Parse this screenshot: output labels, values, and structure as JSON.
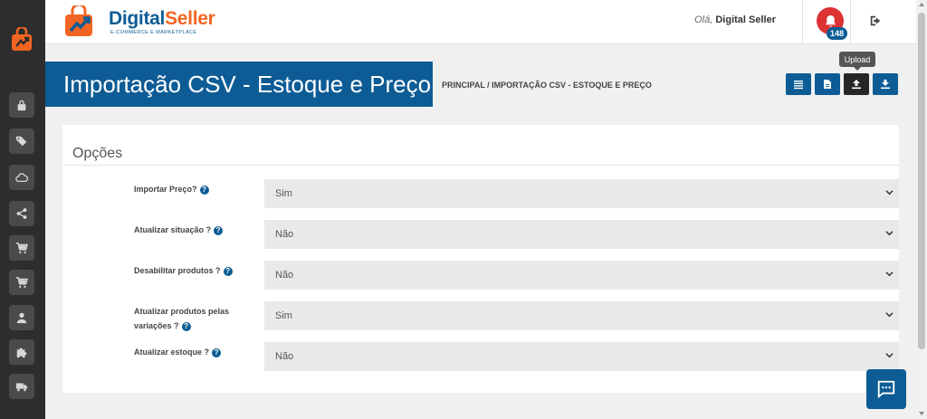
{
  "brand": {
    "name_part1": "Digital",
    "name_part2": "Seller",
    "tagline": "E-COMMERCE E MARKETPLACE",
    "colors": {
      "primary": "#0d5c95",
      "accent": "#f26522",
      "alert": "#dc3232"
    }
  },
  "sidebar": {
    "items": [
      {
        "icon": "lock-icon"
      },
      {
        "icon": "tags-icon"
      },
      {
        "icon": "cloud-icon"
      },
      {
        "icon": "share-icon"
      },
      {
        "icon": "cart-icon"
      },
      {
        "icon": "cart-icon"
      },
      {
        "icon": "user-icon"
      },
      {
        "icon": "puzzle-icon"
      },
      {
        "icon": "truck-icon"
      }
    ]
  },
  "header": {
    "greeting_prefix": "Olá,",
    "user_name": "Digital Seller",
    "notification_count": "148"
  },
  "page": {
    "title": "Importação CSV - Estoque e Preço",
    "breadcrumb": "PRINCIPAL / IMPORTAÇÃO CSV - ESTOQUE E PREÇO"
  },
  "toolbar": {
    "tooltip": "Upload",
    "buttons": [
      {
        "icon": "list-icon"
      },
      {
        "icon": "file-icon"
      },
      {
        "icon": "upload-icon"
      },
      {
        "icon": "download-icon"
      }
    ]
  },
  "options": {
    "title": "Opções",
    "help_glyph": "?",
    "fields": [
      {
        "label": "Importar Preço?",
        "value": "Sim"
      },
      {
        "label": "Atualizar situação ?",
        "value": "Não"
      },
      {
        "label": "Desabilitar produtos ?",
        "value": "Não"
      },
      {
        "label": "Atualizar produtos pelas variações ?",
        "value": "Sim"
      },
      {
        "label": "Atualizar estoque ?",
        "value": "Não"
      }
    ]
  }
}
